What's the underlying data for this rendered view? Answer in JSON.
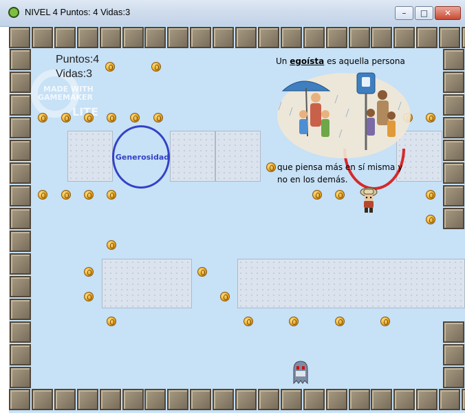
{
  "window": {
    "title": "NIVEL 4 Puntos: 4 Vidas:3",
    "min_label": "–",
    "max_label": "□",
    "close_label": "✕"
  },
  "hud": {
    "points": "Puntos:4",
    "lives": "Vidas:3"
  },
  "watermark": {
    "line1": "MADE WITH",
    "line2": "GAMEMAKER",
    "line3": "LITE"
  },
  "target_word": "Generosidad",
  "dialog": {
    "before": "Un ",
    "keyword": "egoísta",
    "after": " es aquella persona",
    "line2": "que piensa más en sí misma y",
    "line3": "no en los demás."
  },
  "colors": {
    "sky": "#c7e1f6",
    "ring_blue": "#3342c7",
    "ring_red": "#d42a2a"
  },
  "icons": [
    "coin-icon",
    "player-explorer-icon",
    "ghost-enemy-icon",
    "stone-block-icon"
  ]
}
